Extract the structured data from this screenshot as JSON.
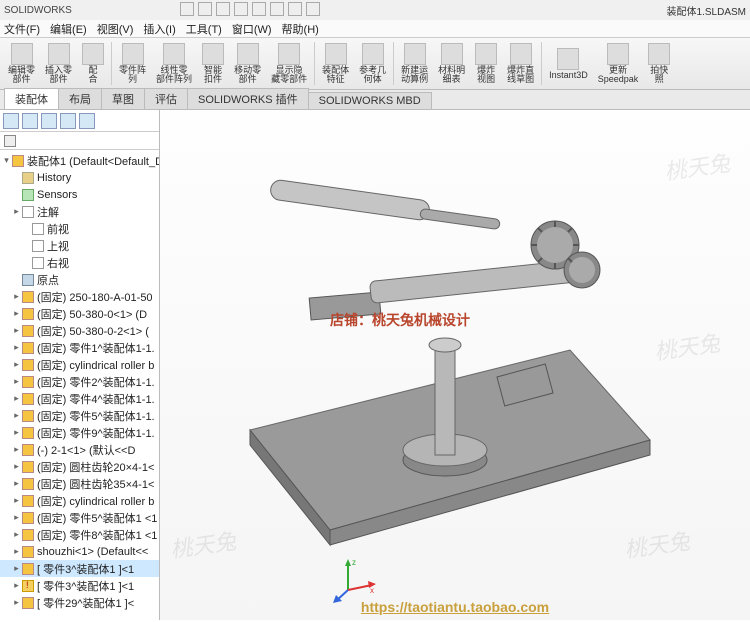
{
  "title_left": "SOLIDWORKS",
  "title_right": "装配体1.SLDASM",
  "menu": [
    "文件(F)",
    "编辑(E)",
    "视图(V)",
    "插入(I)",
    "工具(T)",
    "窗口(W)",
    "帮助(H)"
  ],
  "ribbon": [
    {
      "label": "编辑零\n部件"
    },
    {
      "label": "插入零\n部件"
    },
    {
      "label": "配\n合"
    },
    {
      "label": "零件阵\n列"
    },
    {
      "label": "线性零\n部件阵列"
    },
    {
      "label": "智能\n扣件"
    },
    {
      "label": "移动零\n部件"
    },
    {
      "label": "显示隐\n藏零部件"
    },
    {
      "label": "装配体\n特征"
    },
    {
      "label": "参考几\n何体"
    },
    {
      "label": "新建运\n动算例"
    },
    {
      "label": "材料明\n细表"
    },
    {
      "label": "爆炸\n视图"
    },
    {
      "label": "爆炸直\n线草图"
    },
    {
      "label": "Instant3D"
    },
    {
      "label": "更新\nSpeedpak"
    },
    {
      "label": "拍快\n照"
    }
  ],
  "doc_tabs": [
    "装配体",
    "布局",
    "草图",
    "评估",
    "SOLIDWORKS 插件",
    "SOLIDWORKS MBD"
  ],
  "active_tab": 0,
  "tree_root": "装配体1 (Default<Default_D",
  "tree": [
    {
      "icon": "folder",
      "label": "History",
      "lvl": 1
    },
    {
      "icon": "sensor",
      "label": "Sensors",
      "lvl": 1
    },
    {
      "icon": "doc",
      "label": "注解",
      "lvl": 1,
      "exp": "▸"
    },
    {
      "icon": "doc",
      "label": "前视",
      "lvl": 2
    },
    {
      "icon": "doc",
      "label": "上视",
      "lvl": 2
    },
    {
      "icon": "doc",
      "label": "右视",
      "lvl": 2
    },
    {
      "icon": "origin",
      "label": "原点",
      "lvl": 1
    },
    {
      "icon": "cube",
      "label": "(固定) 250-180-A-01-50",
      "lvl": 1,
      "exp": "▸"
    },
    {
      "icon": "cube",
      "label": "(固定) 50-380-0<1> (D",
      "lvl": 1,
      "exp": "▸"
    },
    {
      "icon": "cube",
      "label": "(固定) 50-380-0-2<1> (",
      "lvl": 1,
      "exp": "▸"
    },
    {
      "icon": "cube",
      "label": "(固定) 零件1^装配体1-1.",
      "lvl": 1,
      "exp": "▸"
    },
    {
      "icon": "cube",
      "label": "(固定) cylindrical roller b",
      "lvl": 1,
      "exp": "▸"
    },
    {
      "icon": "cube",
      "label": "(固定) 零件2^装配体1-1.",
      "lvl": 1,
      "exp": "▸"
    },
    {
      "icon": "cube",
      "label": "(固定) 零件4^装配体1-1.",
      "lvl": 1,
      "exp": "▸"
    },
    {
      "icon": "cube",
      "label": "(固定) 零件5^装配体1-1.",
      "lvl": 1,
      "exp": "▸"
    },
    {
      "icon": "cube",
      "label": "(固定) 零件9^装配体1-1.",
      "lvl": 1,
      "exp": "▸"
    },
    {
      "icon": "cube",
      "label": "(-) 2-1<1> (默认<<D",
      "lvl": 1,
      "exp": "▸"
    },
    {
      "icon": "cube",
      "label": "(固定) 圆柱齿轮20×4-1<",
      "lvl": 1,
      "exp": "▸"
    },
    {
      "icon": "cube",
      "label": "(固定) 圆柱齿轮35×4-1<",
      "lvl": 1,
      "exp": "▸"
    },
    {
      "icon": "cube",
      "label": "(固定) cylindrical roller b",
      "lvl": 1,
      "exp": "▸"
    },
    {
      "icon": "cube",
      "label": "(固定) 零件5^装配体1 <1",
      "lvl": 1,
      "exp": "▸"
    },
    {
      "icon": "cube",
      "label": "(固定) 零件8^装配体1 <1",
      "lvl": 1,
      "exp": "▸"
    },
    {
      "icon": "cube",
      "label": "shouzhi<1> (Default<<",
      "lvl": 1,
      "exp": "▸"
    },
    {
      "icon": "cube",
      "label": "[ 零件3^装配体1 ]<1",
      "lvl": 1,
      "exp": "▸",
      "hl": true
    },
    {
      "icon": "warn",
      "label": "[ 零件3^装配体1 ]<1",
      "lvl": 1,
      "exp": "▸"
    },
    {
      "icon": "cube",
      "label": "[ 零件29^装配体1 ]<",
      "lvl": 1,
      "exp": "▸"
    }
  ],
  "watermark_text": "桃天兔",
  "overlay_text": "店铺：桃天兔机械设计",
  "url": "https://taotiantu.taobao.com"
}
